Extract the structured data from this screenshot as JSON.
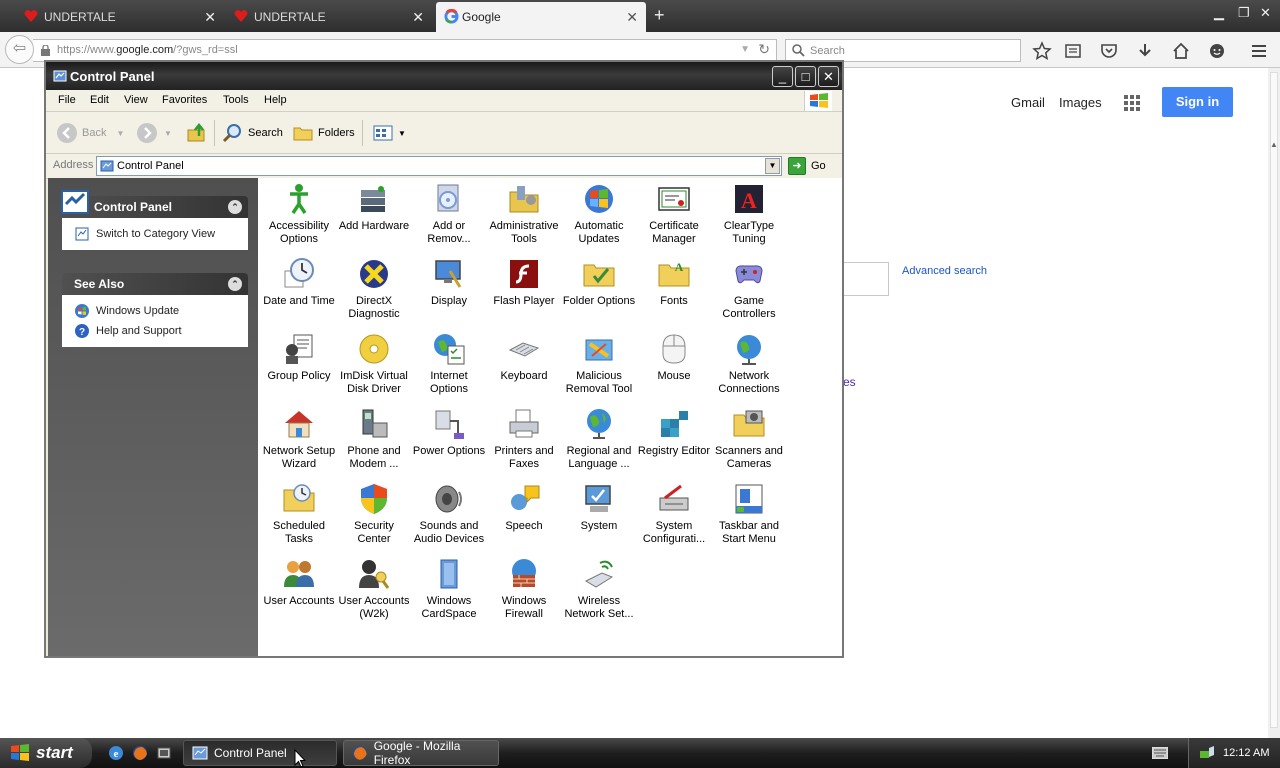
{
  "browser": {
    "tabs": [
      {
        "label": "UNDERTALE",
        "active": false
      },
      {
        "label": "UNDERTALE",
        "active": false
      },
      {
        "label": "Google",
        "active": true
      }
    ],
    "url_prefix": "https://www.",
    "url_domain": "google.com",
    "url_suffix": "/?gws_rd=ssl",
    "search_placeholder": "Search"
  },
  "google": {
    "gmail": "Gmail",
    "images": "Images",
    "sign_in": "Sign in",
    "advanced_search": "Advanced search",
    "link_fragment": "es"
  },
  "window": {
    "title": "Control Panel",
    "menus": [
      "File",
      "Edit",
      "View",
      "Favorites",
      "Tools",
      "Help"
    ],
    "toolbar": {
      "back": "Back",
      "search": "Search",
      "folders": "Folders"
    },
    "address_label": "Address",
    "address_value": "Control Panel",
    "go": "Go"
  },
  "left_panel": {
    "control_panel_title": "Control Panel",
    "switch_view": "Switch to Category View",
    "see_also_title": "See Also",
    "see_also": [
      "Windows Update",
      "Help and Support"
    ]
  },
  "items": [
    [
      "Accessibility",
      "Options"
    ],
    [
      "Add Hardware",
      ""
    ],
    [
      "Add or",
      "Remov..."
    ],
    [
      "Administrative",
      "Tools"
    ],
    [
      "Automatic",
      "Updates"
    ],
    [
      "Certificate",
      "Manager"
    ],
    [
      "ClearType",
      "Tuning"
    ],
    [
      "Date and Time",
      ""
    ],
    [
      "DirectX",
      "Diagnostic"
    ],
    [
      "Display",
      ""
    ],
    [
      "Flash Player",
      ""
    ],
    [
      "Folder Options",
      ""
    ],
    [
      "Fonts",
      ""
    ],
    [
      "Game",
      "Controllers"
    ],
    [
      "Group Policy",
      ""
    ],
    [
      "ImDisk Virtual",
      "Disk Driver"
    ],
    [
      "Internet",
      "Options"
    ],
    [
      "Keyboard",
      ""
    ],
    [
      "Malicious",
      "Removal Tool"
    ],
    [
      "Mouse",
      ""
    ],
    [
      "Network",
      "Connections"
    ],
    [
      "Network Setup",
      "Wizard"
    ],
    [
      "Phone and",
      "Modem ..."
    ],
    [
      "Power Options",
      ""
    ],
    [
      "Printers and",
      "Faxes"
    ],
    [
      "Regional and",
      "Language ..."
    ],
    [
      "Registry Editor",
      ""
    ],
    [
      "Scanners and",
      "Cameras"
    ],
    [
      "Scheduled",
      "Tasks"
    ],
    [
      "Security",
      "Center"
    ],
    [
      "Sounds and",
      "Audio Devices"
    ],
    [
      "Speech",
      ""
    ],
    [
      "System",
      ""
    ],
    [
      "System",
      "Configurati..."
    ],
    [
      "Taskbar and",
      "Start Menu"
    ],
    [
      "User Accounts",
      ""
    ],
    [
      "User Accounts",
      "(W2k)"
    ],
    [
      "Windows",
      "CardSpace"
    ],
    [
      "Windows",
      "Firewall"
    ],
    [
      "Wireless",
      "Network Set..."
    ]
  ],
  "taskbar": {
    "start": "start",
    "buttons": [
      "Control Panel",
      "Google - Mozilla Firefox"
    ],
    "clock": "12:12 AM"
  }
}
